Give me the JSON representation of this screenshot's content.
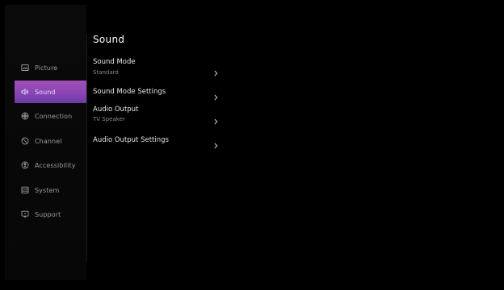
{
  "sidebar": {
    "items": [
      {
        "label": "Picture",
        "icon": "picture-icon"
      },
      {
        "label": "Sound",
        "icon": "sound-icon"
      },
      {
        "label": "Connection",
        "icon": "connection-icon"
      },
      {
        "label": "Channel",
        "icon": "channel-icon"
      },
      {
        "label": "Accessibility",
        "icon": "accessibility-icon"
      },
      {
        "label": "System",
        "icon": "system-icon"
      },
      {
        "label": "Support",
        "icon": "support-icon"
      }
    ],
    "active_color": "#8a45b5"
  },
  "main": {
    "title": "Sound",
    "items": [
      {
        "label": "Sound Mode",
        "value": "Standard"
      },
      {
        "label": "Sound Mode Settings",
        "value": ""
      },
      {
        "label": "Audio Output",
        "value": "TV Speaker"
      },
      {
        "label": "Audio Output Settings",
        "value": ""
      }
    ]
  }
}
